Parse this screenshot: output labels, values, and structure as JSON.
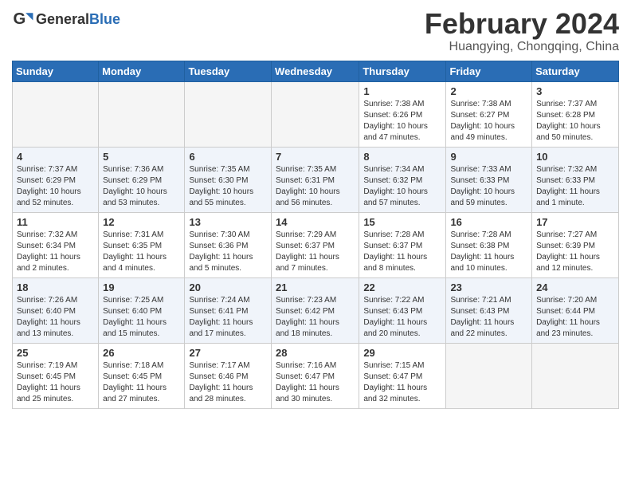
{
  "header": {
    "logo_general": "General",
    "logo_blue": "Blue",
    "title": "February 2024",
    "subtitle": "Huangying, Chongqing, China"
  },
  "days_of_week": [
    "Sunday",
    "Monday",
    "Tuesday",
    "Wednesday",
    "Thursday",
    "Friday",
    "Saturday"
  ],
  "weeks": [
    [
      {
        "day": "",
        "info": ""
      },
      {
        "day": "",
        "info": ""
      },
      {
        "day": "",
        "info": ""
      },
      {
        "day": "",
        "info": ""
      },
      {
        "day": "1",
        "info": "Sunrise: 7:38 AM\nSunset: 6:26 PM\nDaylight: 10 hours\nand 47 minutes."
      },
      {
        "day": "2",
        "info": "Sunrise: 7:38 AM\nSunset: 6:27 PM\nDaylight: 10 hours\nand 49 minutes."
      },
      {
        "day": "3",
        "info": "Sunrise: 7:37 AM\nSunset: 6:28 PM\nDaylight: 10 hours\nand 50 minutes."
      }
    ],
    [
      {
        "day": "4",
        "info": "Sunrise: 7:37 AM\nSunset: 6:29 PM\nDaylight: 10 hours\nand 52 minutes."
      },
      {
        "day": "5",
        "info": "Sunrise: 7:36 AM\nSunset: 6:29 PM\nDaylight: 10 hours\nand 53 minutes."
      },
      {
        "day": "6",
        "info": "Sunrise: 7:35 AM\nSunset: 6:30 PM\nDaylight: 10 hours\nand 55 minutes."
      },
      {
        "day": "7",
        "info": "Sunrise: 7:35 AM\nSunset: 6:31 PM\nDaylight: 10 hours\nand 56 minutes."
      },
      {
        "day": "8",
        "info": "Sunrise: 7:34 AM\nSunset: 6:32 PM\nDaylight: 10 hours\nand 57 minutes."
      },
      {
        "day": "9",
        "info": "Sunrise: 7:33 AM\nSunset: 6:33 PM\nDaylight: 10 hours\nand 59 minutes."
      },
      {
        "day": "10",
        "info": "Sunrise: 7:32 AM\nSunset: 6:33 PM\nDaylight: 11 hours\nand 1 minute."
      }
    ],
    [
      {
        "day": "11",
        "info": "Sunrise: 7:32 AM\nSunset: 6:34 PM\nDaylight: 11 hours\nand 2 minutes."
      },
      {
        "day": "12",
        "info": "Sunrise: 7:31 AM\nSunset: 6:35 PM\nDaylight: 11 hours\nand 4 minutes."
      },
      {
        "day": "13",
        "info": "Sunrise: 7:30 AM\nSunset: 6:36 PM\nDaylight: 11 hours\nand 5 minutes."
      },
      {
        "day": "14",
        "info": "Sunrise: 7:29 AM\nSunset: 6:37 PM\nDaylight: 11 hours\nand 7 minutes."
      },
      {
        "day": "15",
        "info": "Sunrise: 7:28 AM\nSunset: 6:37 PM\nDaylight: 11 hours\nand 8 minutes."
      },
      {
        "day": "16",
        "info": "Sunrise: 7:28 AM\nSunset: 6:38 PM\nDaylight: 11 hours\nand 10 minutes."
      },
      {
        "day": "17",
        "info": "Sunrise: 7:27 AM\nSunset: 6:39 PM\nDaylight: 11 hours\nand 12 minutes."
      }
    ],
    [
      {
        "day": "18",
        "info": "Sunrise: 7:26 AM\nSunset: 6:40 PM\nDaylight: 11 hours\nand 13 minutes."
      },
      {
        "day": "19",
        "info": "Sunrise: 7:25 AM\nSunset: 6:40 PM\nDaylight: 11 hours\nand 15 minutes."
      },
      {
        "day": "20",
        "info": "Sunrise: 7:24 AM\nSunset: 6:41 PM\nDaylight: 11 hours\nand 17 minutes."
      },
      {
        "day": "21",
        "info": "Sunrise: 7:23 AM\nSunset: 6:42 PM\nDaylight: 11 hours\nand 18 minutes."
      },
      {
        "day": "22",
        "info": "Sunrise: 7:22 AM\nSunset: 6:43 PM\nDaylight: 11 hours\nand 20 minutes."
      },
      {
        "day": "23",
        "info": "Sunrise: 7:21 AM\nSunset: 6:43 PM\nDaylight: 11 hours\nand 22 minutes."
      },
      {
        "day": "24",
        "info": "Sunrise: 7:20 AM\nSunset: 6:44 PM\nDaylight: 11 hours\nand 23 minutes."
      }
    ],
    [
      {
        "day": "25",
        "info": "Sunrise: 7:19 AM\nSunset: 6:45 PM\nDaylight: 11 hours\nand 25 minutes."
      },
      {
        "day": "26",
        "info": "Sunrise: 7:18 AM\nSunset: 6:45 PM\nDaylight: 11 hours\nand 27 minutes."
      },
      {
        "day": "27",
        "info": "Sunrise: 7:17 AM\nSunset: 6:46 PM\nDaylight: 11 hours\nand 28 minutes."
      },
      {
        "day": "28",
        "info": "Sunrise: 7:16 AM\nSunset: 6:47 PM\nDaylight: 11 hours\nand 30 minutes."
      },
      {
        "day": "29",
        "info": "Sunrise: 7:15 AM\nSunset: 6:47 PM\nDaylight: 11 hours\nand 32 minutes."
      },
      {
        "day": "",
        "info": ""
      },
      {
        "day": "",
        "info": ""
      }
    ]
  ]
}
